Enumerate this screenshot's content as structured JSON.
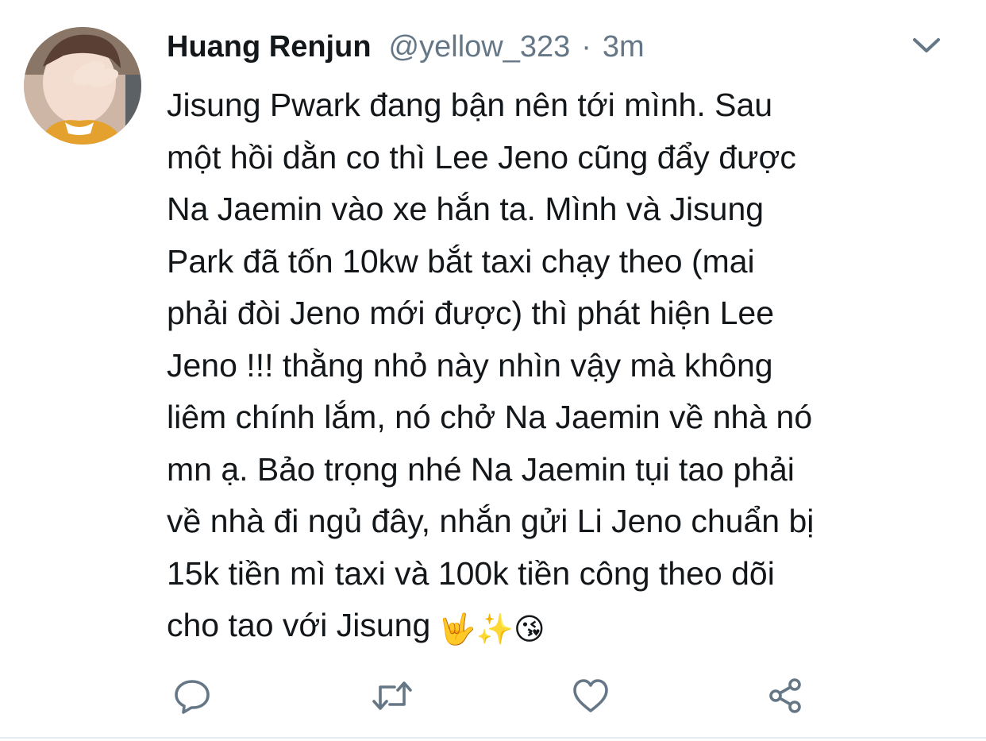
{
  "tweet": {
    "display_name": "Huang Renjun",
    "handle": "@yellow_323",
    "separator": "·",
    "time": "3m",
    "lines": [
      "Jisung Pwark đang bận nên tới mình. Sau",
      "một hồi dằn co thì Lee Jeno cũng đẩy được",
      "Na Jaemin vào xe hắn ta. Mình và Jisung",
      "Park đã tốn 10kw bắt taxi chạy theo (mai",
      "phải đòi Jeno mới được) thì phát hiện Lee",
      "Jeno !!! thằng nhỏ này nhìn vậy mà không",
      "liêm chính lắm, nó chở Na Jaemin về nhà nó",
      "mn ạ. Bảo trọng nhé Na Jaemin tụi tao phải",
      "về nhà đi ngủ đây, nhắn gửi Li Jeno chuẩn bị",
      "15k tiền mì taxi và 100k tiền công theo dõi",
      "cho tao với Jisung"
    ],
    "emojis": [
      "🤟",
      "✨",
      "😘"
    ],
    "icons": {
      "avatar": "profile-photo",
      "menu": "chevron-down-icon",
      "reply": "reply-icon",
      "retweet": "retweet-icon",
      "like": "heart-icon",
      "share": "share-icon"
    }
  },
  "colors": {
    "text": "#14171a",
    "secondary": "#657786",
    "icon": "#657786",
    "divider": "#e6ecf0"
  }
}
